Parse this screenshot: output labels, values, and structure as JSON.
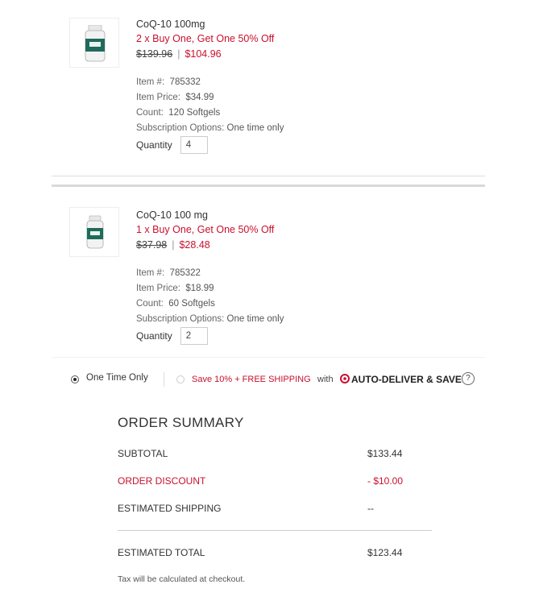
{
  "cart_items": [
    {
      "name": "CoQ-10 100mg",
      "promo": "2 x Buy One, Get One 50% Off",
      "original_price": "$139.96",
      "sale_price": "$104.96",
      "item_number_label": "Item #:",
      "item_number": "785332",
      "item_price_label": "Item Price:",
      "item_price": "$34.99",
      "count_label": "Count:",
      "count": "120 Softgels",
      "subscription_label": "Subscription Options:",
      "subscription": "One time only",
      "quantity_label": "Quantity",
      "quantity": "4"
    },
    {
      "name": "CoQ-10 100 mg",
      "promo": "1 x Buy One, Get One 50% Off",
      "original_price": "$37.98",
      "sale_price": "$28.48",
      "item_number_label": "Item #:",
      "item_number": "785322",
      "item_price_label": "Item Price:",
      "item_price": "$18.99",
      "count_label": "Count:",
      "count": "60 Softgels",
      "subscription_label": "Subscription Options:",
      "subscription": "One time only",
      "quantity_label": "Quantity",
      "quantity": "2"
    }
  ],
  "shipping_options": {
    "one_time_label": "One Time Only",
    "save_label": "Save 10% + FREE SHIPPING",
    "with_label": "with",
    "auto_deliver_label": "AUTO-DELIVER & SAVE",
    "help_symbol": "?"
  },
  "order_summary": {
    "title": "ORDER SUMMARY",
    "subtotal_label": "SUBTOTAL",
    "subtotal": "$133.44",
    "discount_label": "ORDER DISCOUNT",
    "discount": "- $10.00",
    "shipping_label": "ESTIMATED SHIPPING",
    "shipping": "--",
    "total_label": "ESTIMATED TOTAL",
    "total": "$123.44",
    "tax_note": "Tax will be calculated at checkout."
  },
  "colors": {
    "accent_red": "#c8102e",
    "text": "#333333"
  }
}
